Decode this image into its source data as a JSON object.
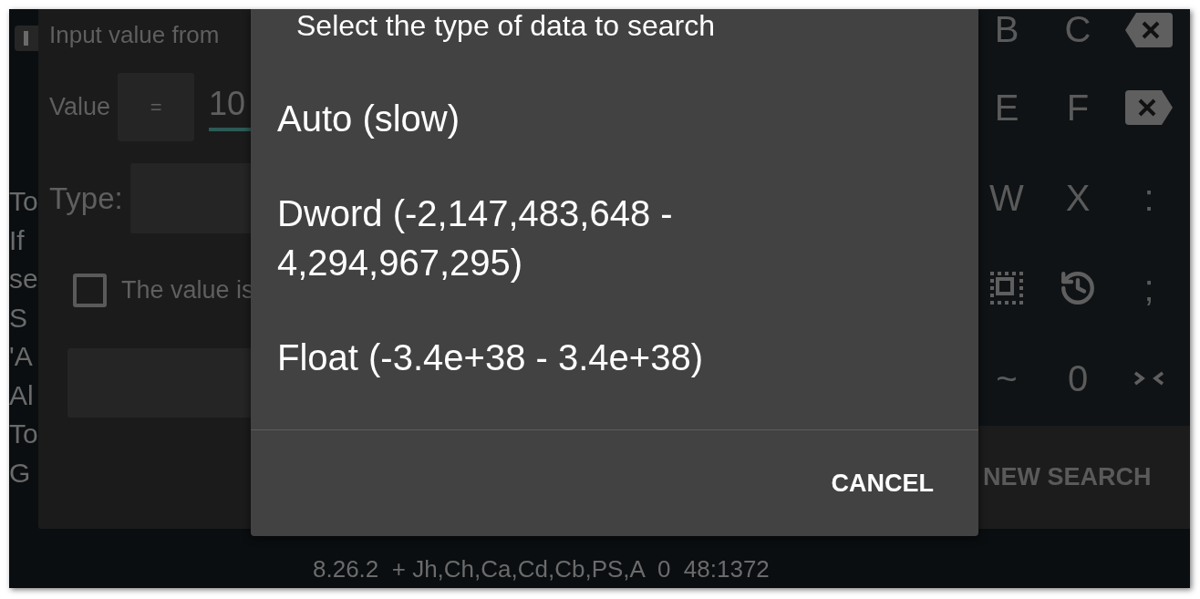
{
  "background_text": [
    "To",
    "If",
    "se",
    "S",
    "'A",
    "Al",
    "To",
    "G"
  ],
  "input_dialog": {
    "title": "Input value from",
    "value_label": "Value",
    "operator": "=",
    "value": "10",
    "type_label": "Type:",
    "checkbox": {
      "label": "The value is",
      "checked": false
    },
    "new_search_button": "NEW SEARCH"
  },
  "keyboard": {
    "rows": [
      [
        {
          "kind": "text",
          "label": "B"
        },
        {
          "kind": "text",
          "label": "C"
        },
        {
          "kind": "backspace"
        }
      ],
      [
        {
          "kind": "text",
          "label": "E"
        },
        {
          "kind": "text",
          "label": "F"
        },
        {
          "kind": "delete"
        }
      ],
      [
        {
          "kind": "text",
          "label": "W"
        },
        {
          "kind": "text",
          "label": "X"
        },
        {
          "kind": "text",
          "label": ":"
        }
      ],
      [
        {
          "kind": "select_all"
        },
        {
          "kind": "history"
        },
        {
          "kind": "text",
          "label": ";"
        }
      ],
      [
        {
          "kind": "text",
          "label": "~"
        },
        {
          "kind": "text",
          "label": "0"
        },
        {
          "kind": "collapse"
        }
      ]
    ]
  },
  "type_dialog": {
    "title": "Select the type of data to search",
    "options": [
      "Auto (slow)",
      "Dword (-2,147,483,648 - 4,294,967,295)",
      "Float (-3.4e+38 - 3.4e+38)"
    ],
    "cancel_button": "CANCEL"
  },
  "status_bar": "8.26.2  + Jh,Ch,Ca,Cd,Cb,PS,A  0  48:1372"
}
